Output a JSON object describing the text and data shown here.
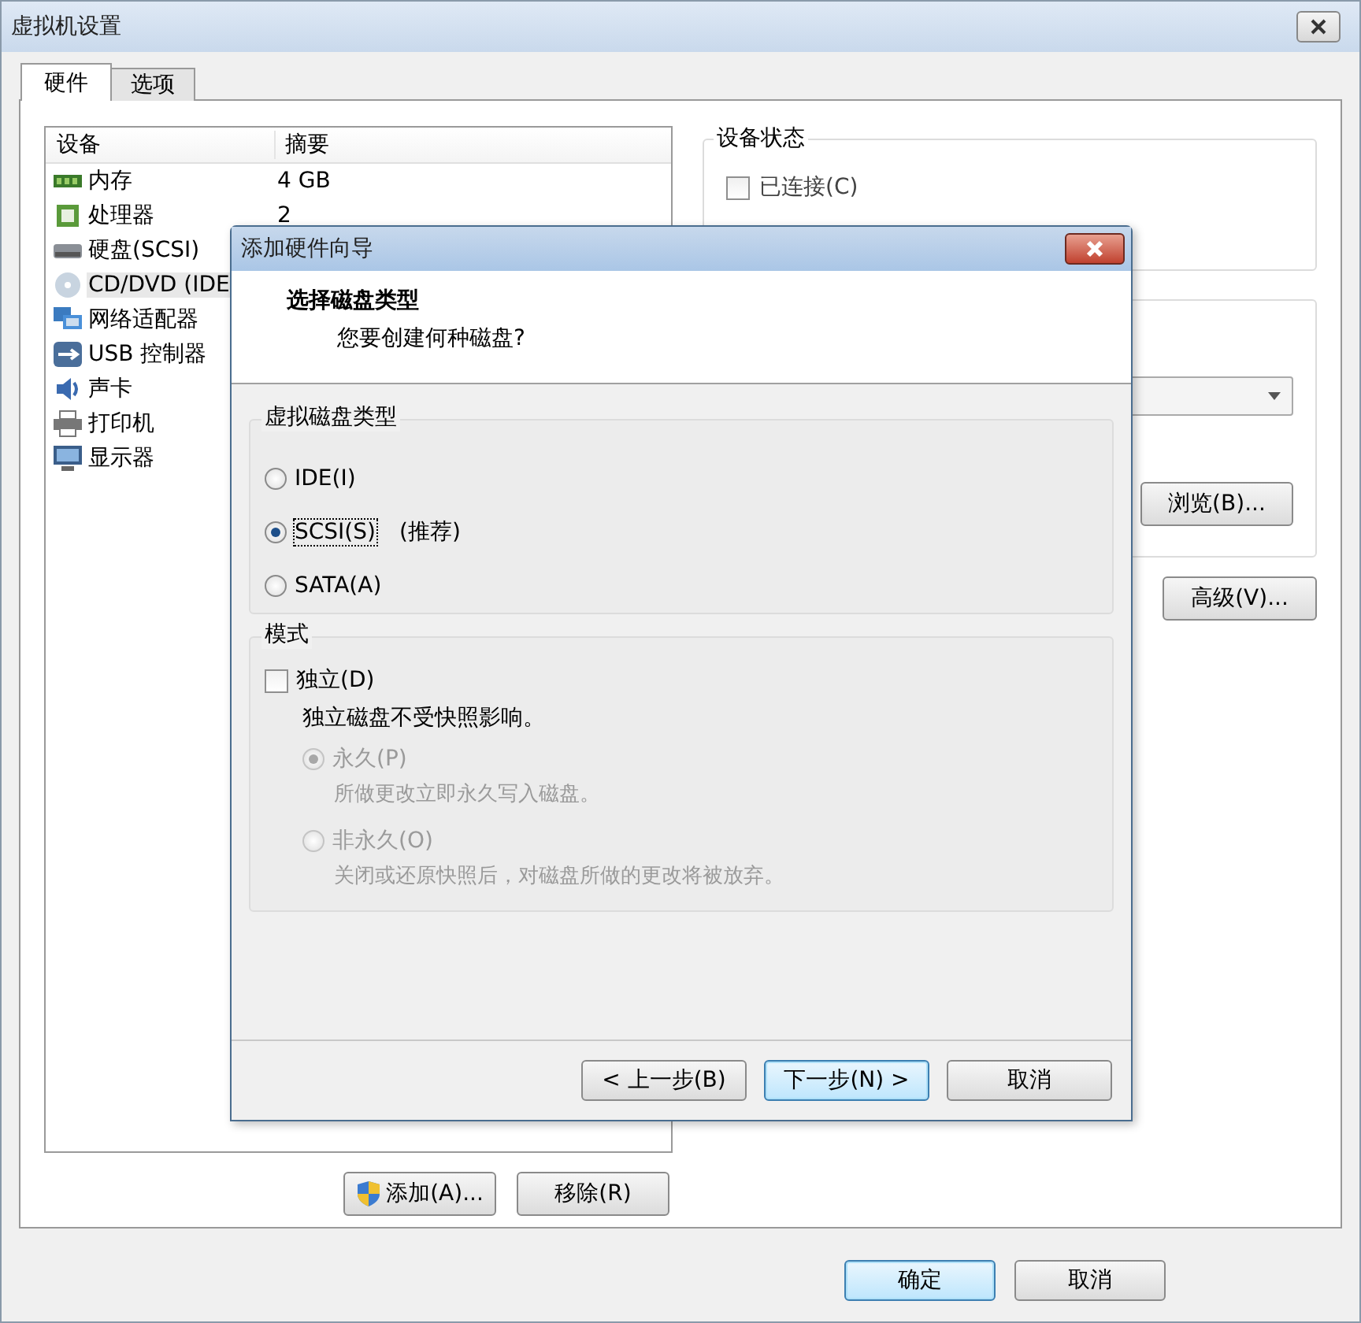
{
  "window": {
    "title": "虚拟机设置"
  },
  "tabs": [
    {
      "label": "硬件",
      "selected": true
    },
    {
      "label": "选项",
      "selected": false
    }
  ],
  "device_table": {
    "columns": [
      "设备",
      "摘要"
    ],
    "rows": [
      {
        "kind": "memory",
        "device": "内存",
        "summary": "4 GB",
        "selected": false
      },
      {
        "kind": "cpu",
        "device": "处理器",
        "summary": "2",
        "selected": false
      },
      {
        "kind": "disk",
        "device": "硬盘(SCSI)",
        "selected": false
      },
      {
        "kind": "cdrom",
        "device": "CD/DVD (IDE",
        "selected": true
      },
      {
        "kind": "network",
        "device": "网络适配器",
        "selected": false
      },
      {
        "kind": "usb",
        "device": "USB 控制器",
        "selected": false
      },
      {
        "kind": "sound",
        "device": "声卡",
        "selected": false
      },
      {
        "kind": "printer",
        "device": "打印机",
        "selected": false
      },
      {
        "kind": "display",
        "device": "显示器",
        "selected": false
      }
    ]
  },
  "device_buttons": [
    {
      "label": "添加(A)...",
      "shield": true
    },
    {
      "label": "移除(R)",
      "shield": false
    }
  ],
  "device_status": {
    "title": "设备状态",
    "options": [
      {
        "label": "已连接(C)",
        "checked": false
      }
    ]
  },
  "browse_button": "浏览(B)...",
  "advanced_button": "高级(V)...",
  "footer_buttons": [
    {
      "label": "确定",
      "default": true
    },
    {
      "label": "取消",
      "default": false
    }
  ],
  "wizard": {
    "title": "添加硬件向导",
    "heading": "选择磁盘类型",
    "subheading": "您要创建何种磁盘?",
    "disk_type": {
      "title": "虚拟磁盘类型",
      "options": [
        {
          "label": "IDE(I)",
          "selected": false
        },
        {
          "label": "SCSI(S)",
          "note": "(推荐)",
          "selected": true
        },
        {
          "label": "SATA(A)",
          "selected": false
        }
      ]
    },
    "mode": {
      "title": "模式",
      "independent": {
        "label": "独立(D)",
        "checked": false
      },
      "description": "独立磁盘不受快照影响。",
      "options": [
        {
          "label": "永久(P)",
          "description": "所做更改立即永久写入磁盘。",
          "selected": true,
          "disabled": true
        },
        {
          "label": "非永久(O)",
          "description": "关闭或还原快照后，对磁盘所做的更改将被放弃。",
          "selected": false,
          "disabled": true
        }
      ]
    },
    "buttons": [
      {
        "label": "< 上一步(B)",
        "default": false
      },
      {
        "label": "下一步(N) >",
        "default": true
      },
      {
        "label": "取消",
        "default": false
      }
    ]
  }
}
